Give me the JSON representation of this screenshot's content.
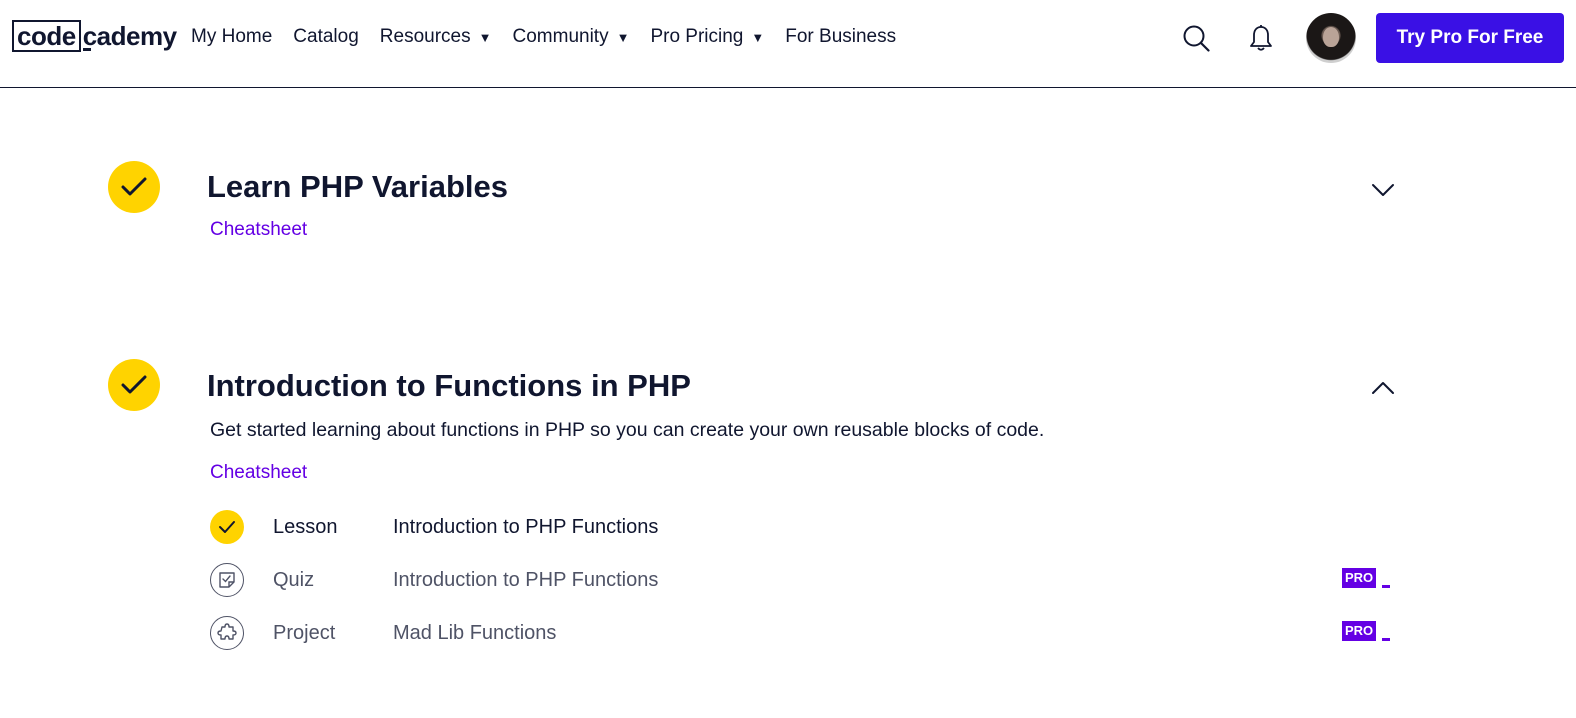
{
  "header": {
    "logo": {
      "part1": "code",
      "part2": "cademy"
    },
    "nav": [
      {
        "label": "My Home",
        "has_caret": false
      },
      {
        "label": "Catalog",
        "has_caret": false
      },
      {
        "label": "Resources",
        "has_caret": true
      },
      {
        "label": "Community",
        "has_caret": true
      },
      {
        "label": "Pro Pricing",
        "has_caret": true
      },
      {
        "label": "For Business",
        "has_caret": false
      }
    ],
    "caret": "▼",
    "cta_label": "Try Pro For Free",
    "icons": [
      "search-icon",
      "bell-icon"
    ]
  },
  "modules": [
    {
      "title": "Learn PHP Variables",
      "completed": true,
      "expanded": false,
      "cheatsheet_label": "Cheatsheet"
    },
    {
      "title": "Introduction to Functions in PHP",
      "completed": true,
      "expanded": true,
      "description": "Get started learning about functions in PHP so you can create your own reusable blocks of code.",
      "cheatsheet_label": "Cheatsheet",
      "items": [
        {
          "type": "Lesson",
          "name": "Introduction to PHP Functions",
          "status": "completed",
          "pro": false
        },
        {
          "type": "Quiz",
          "name": "Introduction to PHP Functions",
          "status": "locked",
          "pro": true,
          "pro_label": "PRO"
        },
        {
          "type": "Project",
          "name": "Mad Lib Functions",
          "status": "locked",
          "pro": true,
          "pro_label": "PRO"
        }
      ]
    }
  ],
  "colors": {
    "navy": "#10162f",
    "yellow": "#ffd300",
    "purple_link": "#6400e4",
    "cta_blue": "#3a10e5",
    "muted_text": "#4f5366"
  }
}
